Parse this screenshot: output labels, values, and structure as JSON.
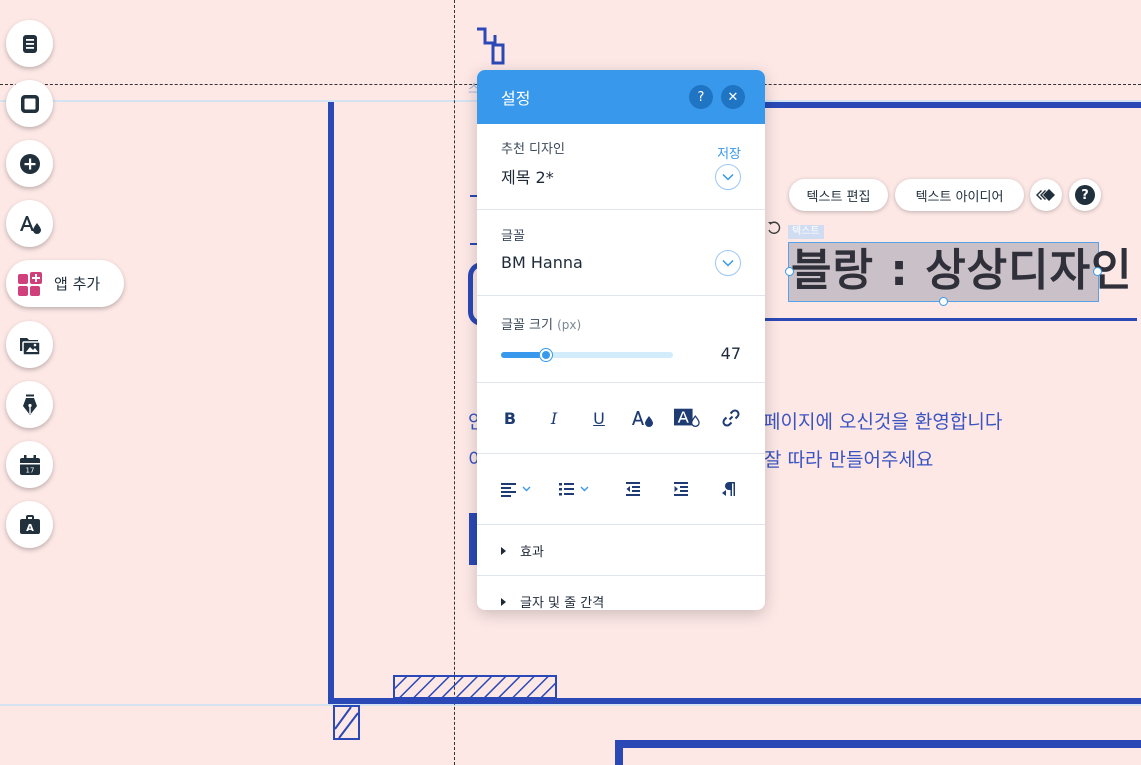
{
  "left_toolbar": {
    "items": [
      {
        "name": "pages-icon"
      },
      {
        "name": "background-icon"
      },
      {
        "name": "add-icon"
      },
      {
        "name": "theme-icon"
      },
      {
        "name": "app-add",
        "label": "앱 추가"
      },
      {
        "name": "media-icon"
      },
      {
        "name": "blog-icon"
      },
      {
        "name": "bookings-icon"
      },
      {
        "name": "my-business-icon"
      }
    ]
  },
  "site": {
    "line1": "페이지에 오신것을 환영합니다",
    "line2": "잘 따라 만들어주세요",
    "frag_line1": "안",
    "frag_line2": "이",
    "frag_tab": "스"
  },
  "panel": {
    "title": "설정",
    "help": "?",
    "close": "✕",
    "design": {
      "label": "추천 디자인",
      "value": "제목 2*",
      "save": "저장"
    },
    "font": {
      "label": "글꼴",
      "value": "BM Hanna"
    },
    "size": {
      "label": "글꼴 크기",
      "unit": "(px)",
      "value": "47",
      "fill_fraction": 0.26
    },
    "format": {
      "bold": "B",
      "italic": "I",
      "underline": "U"
    },
    "accordions": [
      "효과",
      "글자 및 줄 간격"
    ]
  },
  "text_toolbar": {
    "edit_text": "텍스트 편집",
    "text_ideas": "텍스트 아이디어",
    "help": "?"
  },
  "selected_text": {
    "tag": "텍스트",
    "content": "블랑 : 상상디자인"
  },
  "colors": {
    "background": "#fde8e6",
    "frame": "#2b49b6",
    "panel_accent": "#3899ec",
    "site_text": "#3a54c2"
  }
}
